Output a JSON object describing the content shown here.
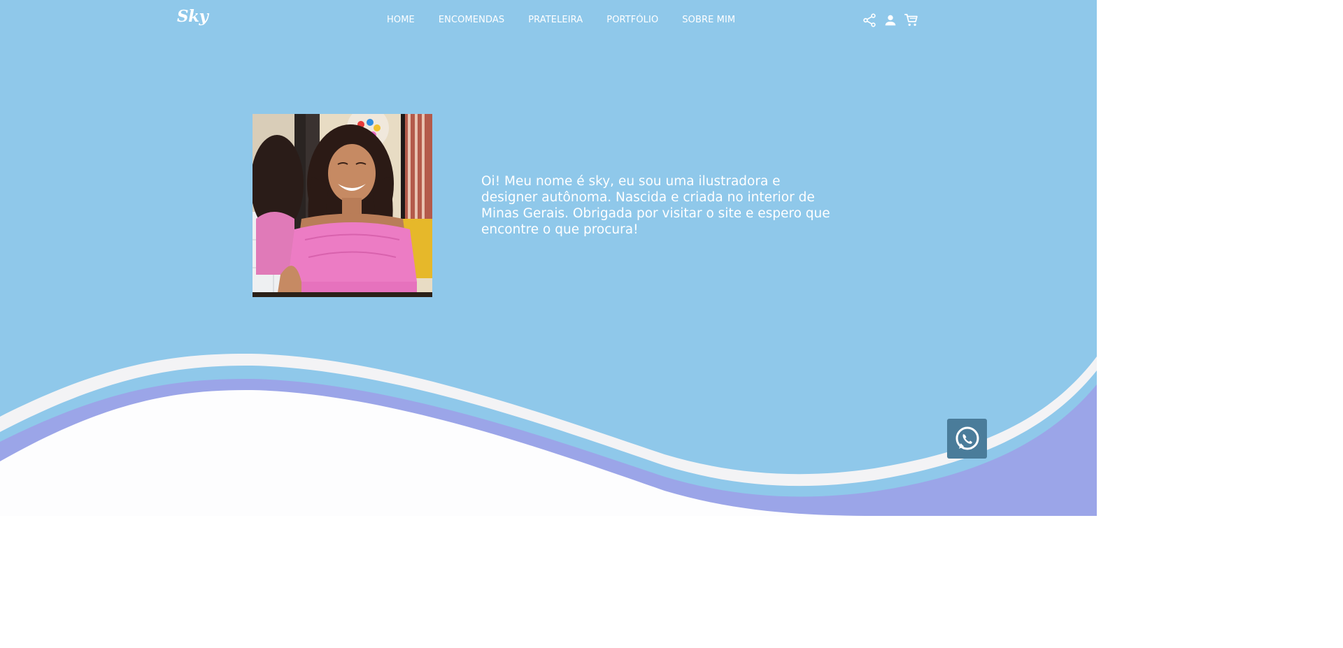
{
  "header": {
    "logo_text": "Sky",
    "nav": [
      {
        "label": "HOME"
      },
      {
        "label": "ENCOMENDAS"
      },
      {
        "label": "PRATELEIRA"
      },
      {
        "label": "PORTFÓLIO"
      },
      {
        "label": "SOBRE MIM"
      }
    ],
    "icons": [
      "share-icon",
      "user-icon",
      "cart-icon"
    ]
  },
  "about": {
    "text": "Oi! Meu nome é sky, eu sou uma ilustradora e designer autônoma. Nascida e criada no interior de Minas Gerais. Obrigada por visitar o site e espero que encontre o que procura!"
  },
  "whatsapp": {
    "icon": "whatsapp-icon"
  },
  "colors": {
    "background": "#8fc8ea",
    "wave_light": "#f3f3f5",
    "wave_purple": "#9ba5e8",
    "whatsapp_button": "#4a7c9a",
    "footer": "#ffffff"
  }
}
